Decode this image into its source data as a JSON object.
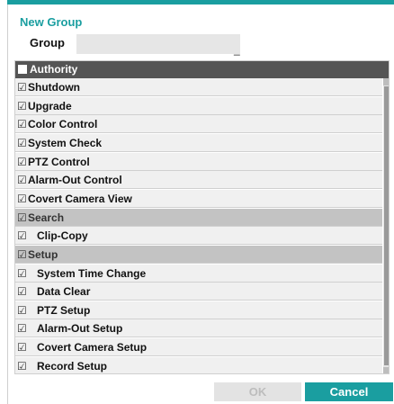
{
  "dialog": {
    "title": "New Group",
    "group_label": "Group",
    "group_value": "",
    "accent_color": "#1a9ea0"
  },
  "authority": {
    "header_label": "Authority",
    "header_checked": false,
    "items": [
      {
        "label": "Shutdown",
        "checked": true,
        "type": "item"
      },
      {
        "label": "Upgrade",
        "checked": true,
        "type": "item"
      },
      {
        "label": "Color Control",
        "checked": true,
        "type": "item"
      },
      {
        "label": "System Check",
        "checked": true,
        "type": "item"
      },
      {
        "label": "PTZ Control",
        "checked": true,
        "type": "item"
      },
      {
        "label": "Alarm-Out Control",
        "checked": true,
        "type": "item"
      },
      {
        "label": "Covert Camera View",
        "checked": true,
        "type": "item"
      },
      {
        "label": "Search",
        "checked": true,
        "type": "section"
      },
      {
        "label": "Clip-Copy",
        "checked": true,
        "type": "subitem"
      },
      {
        "label": "Setup",
        "checked": true,
        "type": "section"
      },
      {
        "label": "System Time Change",
        "checked": true,
        "type": "subitem"
      },
      {
        "label": "Data Clear",
        "checked": true,
        "type": "subitem"
      },
      {
        "label": "PTZ Setup",
        "checked": true,
        "type": "subitem"
      },
      {
        "label": "Alarm-Out Setup",
        "checked": true,
        "type": "subitem"
      },
      {
        "label": "Covert Camera Setup",
        "checked": true,
        "type": "subitem"
      },
      {
        "label": "Record Setup",
        "checked": true,
        "type": "subitem"
      }
    ]
  },
  "buttons": {
    "ok_label": "OK",
    "cancel_label": "Cancel"
  },
  "icons": {
    "check_glyph": "☑",
    "caret_glyph": "_"
  }
}
